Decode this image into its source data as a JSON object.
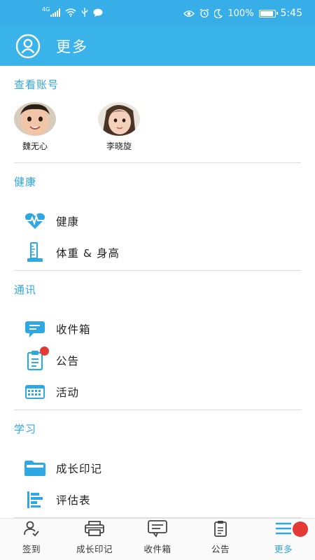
{
  "status_bar": {
    "network": "4G",
    "battery": "100%",
    "time": "5:45"
  },
  "header": {
    "title": "更多"
  },
  "sections": {
    "accounts": {
      "title": "查看账号",
      "children": [
        {
          "name": "魏无心"
        },
        {
          "name": "李晓旋"
        }
      ]
    },
    "health": {
      "title": "健康",
      "items": [
        {
          "label": "健康",
          "icon": "heartbeat-icon"
        },
        {
          "label": "体重 & 身高",
          "icon": "ruler-icon"
        }
      ]
    },
    "comm": {
      "title": "通讯",
      "items": [
        {
          "label": "收件箱",
          "icon": "message-icon"
        },
        {
          "label": "公告",
          "icon": "clipboard-icon"
        },
        {
          "label": "活动",
          "icon": "calendar-icon"
        }
      ]
    },
    "study": {
      "title": "学习",
      "items": [
        {
          "label": "成长印记",
          "icon": "folder-icon"
        },
        {
          "label": "评估表",
          "icon": "bar-list-icon"
        }
      ]
    }
  },
  "bottom_nav": [
    {
      "label": "签到",
      "icon": "checkin-icon"
    },
    {
      "label": "成长印记",
      "icon": "printer-icon"
    },
    {
      "label": "收件箱",
      "icon": "message-icon"
    },
    {
      "label": "公告",
      "icon": "clipboard-icon"
    },
    {
      "label": "更多",
      "icon": "menu-icon",
      "active": true
    }
  ],
  "colors": {
    "primary": "#3ab3ea",
    "accent_text": "#2fa7e3",
    "badge": "#e53935"
  }
}
